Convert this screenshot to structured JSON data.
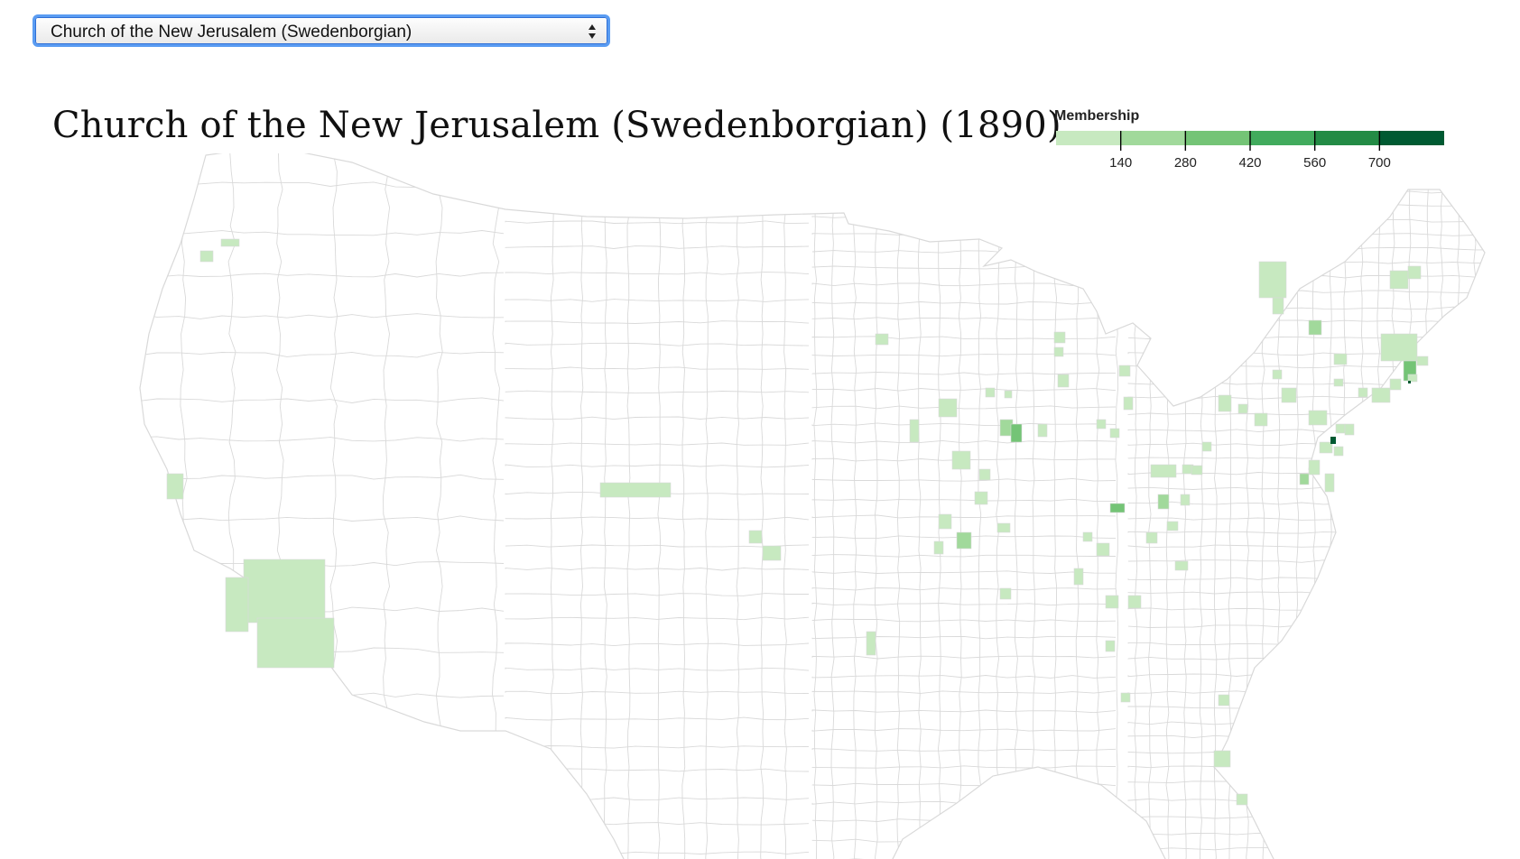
{
  "selector": {
    "selected": "Church of the New Jerusalem (Swedenborgian)",
    "icon": "up-down-arrows-icon"
  },
  "title": "Church of the New Jerusalem (Swedenborgian) (1890)",
  "legend": {
    "title": "Membership",
    "thresholds": [
      140,
      280,
      420,
      560,
      700
    ],
    "tick_labels": [
      "140",
      "280",
      "420",
      "560",
      "700"
    ],
    "colors": [
      "#c7e9c0",
      "#a1d99b",
      "#74c476",
      "#41ab5d",
      "#238b45",
      "#005a32"
    ]
  },
  "map": {
    "type": "choropleth",
    "region_level": "county",
    "extent": "contiguous United States",
    "border_color": "#d9d9d9",
    "empty_fill": "#ffffff"
  }
}
